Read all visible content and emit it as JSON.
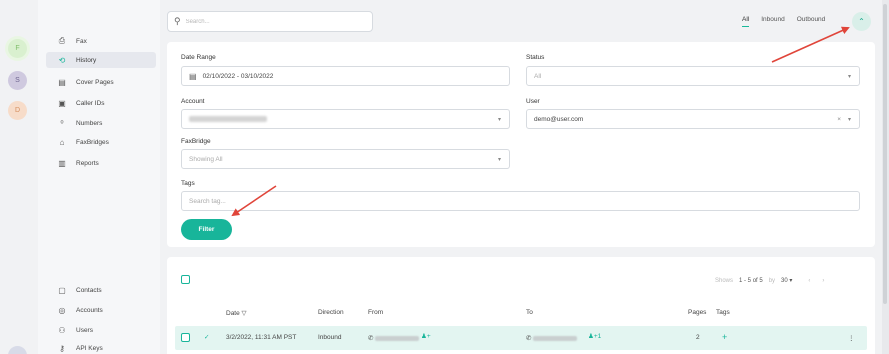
{
  "avatars": [
    "F",
    "S",
    "D"
  ],
  "sidebar": {
    "items": [
      {
        "label": "Fax",
        "icon": "fax-icon",
        "glyph": "⎙"
      },
      {
        "label": "History",
        "icon": "history-icon",
        "glyph": "⟲"
      },
      {
        "label": "Cover Pages",
        "icon": "cover-pages-icon",
        "glyph": "▤"
      },
      {
        "label": "Caller IDs",
        "icon": "caller-id-icon",
        "glyph": "▣"
      },
      {
        "label": "Numbers",
        "icon": "numbers-icon",
        "glyph": "⁰"
      },
      {
        "label": "FaxBridges",
        "icon": "faxbridge-icon",
        "glyph": "⌂"
      },
      {
        "label": "Reports",
        "icon": "reports-icon",
        "glyph": "▥"
      }
    ],
    "bottom_items": [
      {
        "label": "Contacts",
        "icon": "contacts-icon",
        "glyph": "▢"
      },
      {
        "label": "Accounts",
        "icon": "accounts-icon",
        "glyph": "◎"
      },
      {
        "label": "Users",
        "icon": "users-icon",
        "glyph": "⚇"
      },
      {
        "label": "API Keys",
        "icon": "key-icon",
        "glyph": "⚷"
      }
    ]
  },
  "search": {
    "placeholder": "Search..."
  },
  "tabs": [
    "All",
    "Inbound",
    "Outbound"
  ],
  "filters": {
    "date_range_label": "Date Range",
    "date_range_value": "02/10/2022 - 03/10/2022",
    "status_label": "Status",
    "status_value": "All",
    "account_label": "Account",
    "user_label": "User",
    "user_value": "demo@user.com",
    "faxbridge_label": "FaxBridge",
    "faxbridge_value": "Showing All",
    "tags_label": "Tags",
    "tags_placeholder": "Search tag...",
    "filter_button": "Filter"
  },
  "results": {
    "shows_label": "Shows",
    "shows_range": "1 - 5 of 5",
    "by_label": "by",
    "per_page": "30",
    "columns": [
      "Date",
      "Direction",
      "From",
      "To",
      "Pages",
      "Tags"
    ],
    "rows": [
      {
        "date": "3/2/2022, 11:31 AM PST",
        "direction": "Inbound",
        "to_extra": "+1",
        "pages": "2"
      }
    ]
  },
  "colors": {
    "accent": "#18b59a",
    "row_highlight": "#e3f5f1",
    "annotation": "#e0453a"
  }
}
